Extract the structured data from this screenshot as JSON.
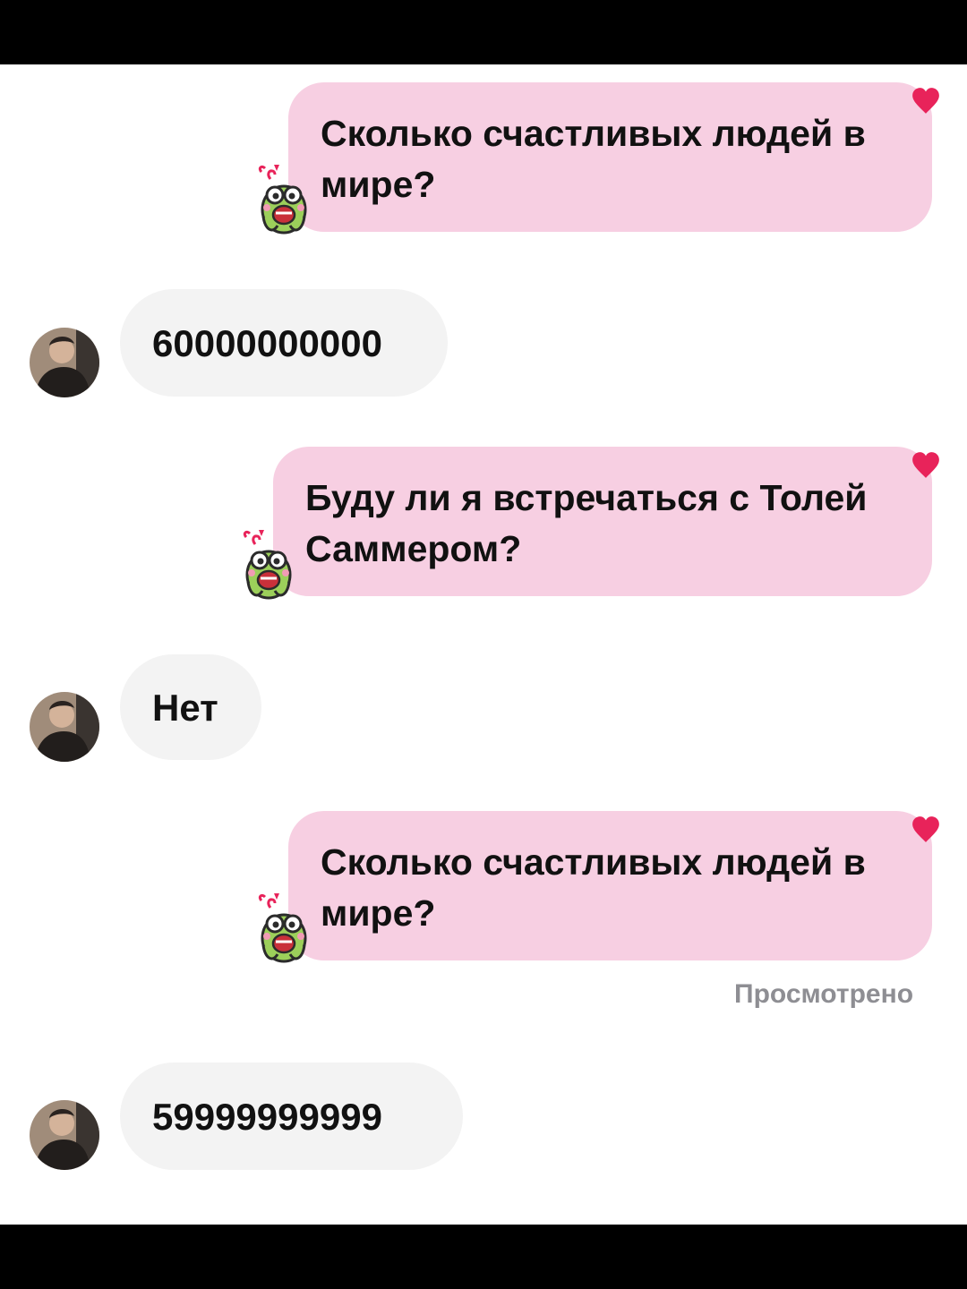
{
  "messages": [
    {
      "direction": "sent",
      "text": "Сколько счастливых людей в мире?",
      "liked": true
    },
    {
      "direction": "received",
      "text": "60000000000"
    },
    {
      "direction": "sent",
      "text": "Буду ли я встречаться с Толей Саммером?",
      "liked": true
    },
    {
      "direction": "received",
      "text": "Нет"
    },
    {
      "direction": "sent",
      "text": "Сколько счастливых людей в мире?",
      "liked": true
    },
    {
      "direction": "received",
      "text": "59999999999"
    }
  ],
  "status": {
    "seen": "Просмотрено"
  },
  "icons": {
    "reaction_sticker": "frog-sticker-icon",
    "like": "heart-icon",
    "contact": "avatar"
  },
  "colors": {
    "sent_bubble": "#f7cfe2",
    "received_bubble": "#f3f3f3",
    "heart": "#e8235a"
  }
}
